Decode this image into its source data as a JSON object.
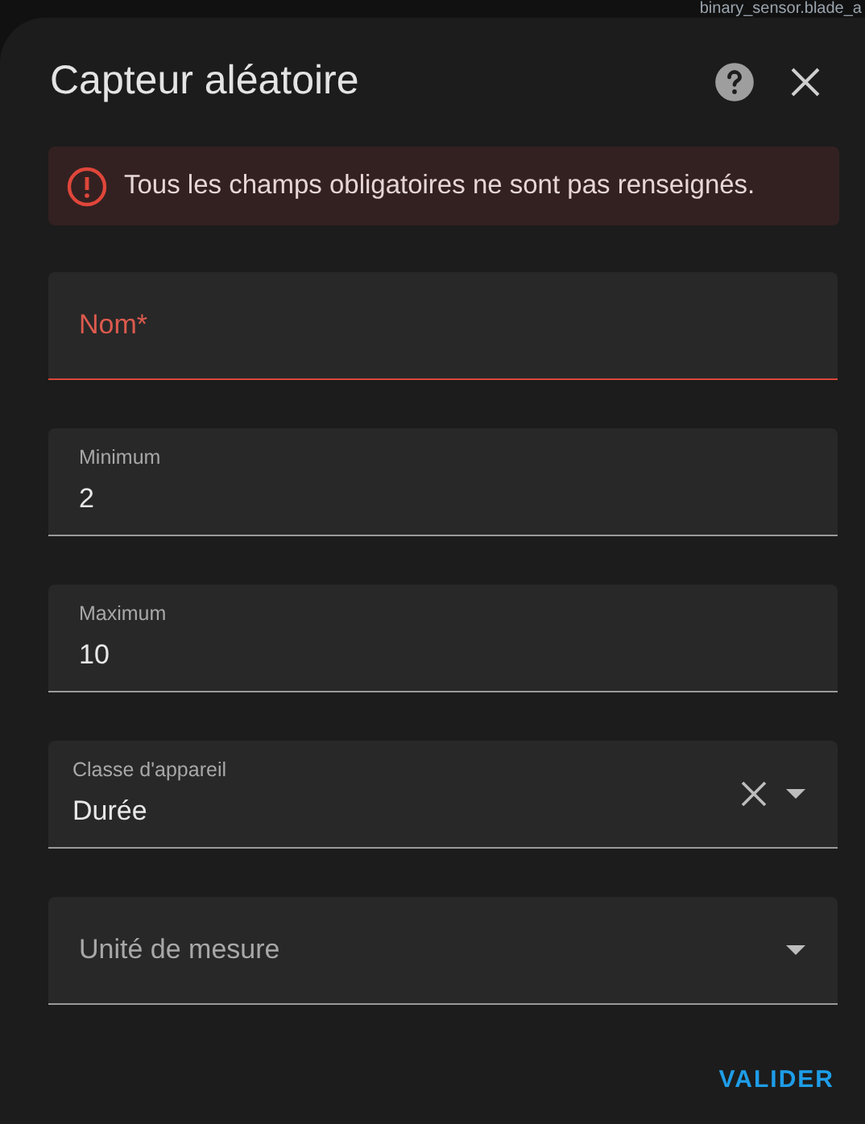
{
  "background_text": "binary_sensor.blade_a",
  "dialog": {
    "title": "Capteur aléatoire",
    "alert": {
      "message": "Tous les champs obligatoires ne sont pas renseignés."
    },
    "fields": [
      {
        "kind": "text",
        "label": "Nom*",
        "error": true
      },
      {
        "kind": "text",
        "label": "Minimum",
        "value": "2",
        "error": false
      },
      {
        "kind": "text",
        "label": "Maximum",
        "value": "10",
        "error": false
      },
      {
        "kind": "select",
        "label": "Classe d'appareil",
        "value": "Durée",
        "error": false,
        "clearable": true
      },
      {
        "kind": "select",
        "label": "Unité de mesure",
        "error": false,
        "clearable": false
      }
    ],
    "buttons": [
      "VALIDER"
    ]
  }
}
